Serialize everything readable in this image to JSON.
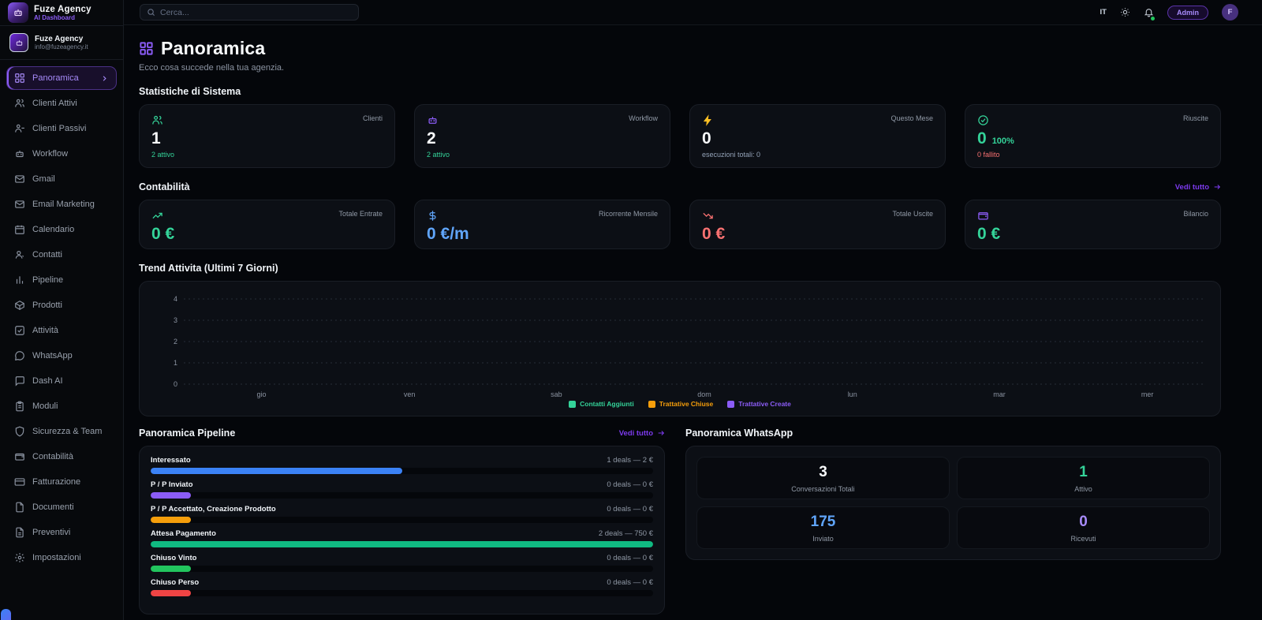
{
  "app": {
    "name": "Fuze Agency",
    "subtitle": "AI Dashboard"
  },
  "account": {
    "name": "Fuze Agency",
    "email": "info@fuzeagency.it"
  },
  "topbar": {
    "search_placeholder": "Cerca...",
    "language": "IT",
    "admin_badge": "Admin",
    "avatar_initial": "F"
  },
  "sidebar": {
    "items": [
      {
        "label": "Panoramica",
        "icon": "grid-icon",
        "active": true
      },
      {
        "label": "Clienti Attivi",
        "icon": "users-icon",
        "active": false
      },
      {
        "label": "Clienti Passivi",
        "icon": "user-minus-icon",
        "active": false
      },
      {
        "label": "Workflow",
        "icon": "bot-icon",
        "active": false
      },
      {
        "label": "Gmail",
        "icon": "mail-icon",
        "active": false
      },
      {
        "label": "Email Marketing",
        "icon": "mail-icon",
        "active": false
      },
      {
        "label": "Calendario",
        "icon": "calendar-icon",
        "active": false
      },
      {
        "label": "Contatti",
        "icon": "contact-icon",
        "active": false
      },
      {
        "label": "Pipeline",
        "icon": "bar-chart-icon",
        "active": false
      },
      {
        "label": "Prodotti",
        "icon": "package-icon",
        "active": false
      },
      {
        "label": "Attività",
        "icon": "check-square-icon",
        "active": false
      },
      {
        "label": "WhatsApp",
        "icon": "message-circle-icon",
        "active": false
      },
      {
        "label": "Dash AI",
        "icon": "message-square-icon",
        "active": false
      },
      {
        "label": "Moduli",
        "icon": "clipboard-icon",
        "active": false
      },
      {
        "label": "Sicurezza & Team",
        "icon": "shield-icon",
        "active": false
      },
      {
        "label": "Contabilità",
        "icon": "wallet-icon",
        "active": false
      },
      {
        "label": "Fatturazione",
        "icon": "credit-card-icon",
        "active": false
      },
      {
        "label": "Documenti",
        "icon": "file-icon",
        "active": false
      },
      {
        "label": "Preventivi",
        "icon": "file-text-icon",
        "active": false
      },
      {
        "label": "Impostazioni",
        "icon": "settings-icon",
        "active": false
      }
    ]
  },
  "page": {
    "title": "Panoramica",
    "subtitle": "Ecco cosa succede nella tua agenzia."
  },
  "sections": {
    "system": {
      "title": "Statistiche di Sistema",
      "cards": [
        {
          "label": "Clienti",
          "value": "1",
          "sub": "2 attivo",
          "icon": "users-icon",
          "icon_color": "#34d399",
          "value_color": "#f8fafc",
          "sub_color": "#34d399"
        },
        {
          "label": "Workflow",
          "value": "2",
          "sub": "2 attivo",
          "icon": "bot-icon",
          "icon_color": "#8b5cf6",
          "value_color": "#f8fafc",
          "sub_color": "#34d399"
        },
        {
          "label": "Questo Mese",
          "value": "0",
          "sub": "esecuzioni totali: 0",
          "icon": "zap-icon",
          "icon_color": "#fbbf24",
          "value_color": "#f8fafc",
          "sub_color": "#94a3b8"
        },
        {
          "label": "Riuscite",
          "value": "0",
          "value_suffix": "100%",
          "sub": "0 fallito",
          "icon": "check-circle-icon",
          "icon_color": "#34d399",
          "value_color": "#34d399",
          "sub_color": "#f87171"
        }
      ]
    },
    "accounting": {
      "title": "Contabilità",
      "link_label": "Vedi tutto",
      "cards": [
        {
          "label": "Totale Entrate",
          "value": "0 €",
          "icon": "trending-up-icon",
          "icon_color": "#34d399",
          "value_color": "#34d399"
        },
        {
          "label": "Ricorrente Mensile",
          "value": "0 €/m",
          "icon": "dollar-icon",
          "icon_color": "#60a5fa",
          "value_color": "#60a5fa"
        },
        {
          "label": "Totale Uscite",
          "value": "0 €",
          "icon": "trending-down-icon",
          "icon_color": "#f87171",
          "value_color": "#f87171"
        },
        {
          "label": "Bilancio",
          "value": "0 €",
          "icon": "wallet-icon",
          "icon_color": "#8b5cf6",
          "value_color": "#34d399"
        }
      ]
    },
    "trend": {
      "title": "Trend Attivita (Ultimi 7 Giorni)"
    },
    "pipeline": {
      "title": "Panoramica Pipeline",
      "link_label": "Vedi tutto",
      "stages": [
        {
          "label": "Interessato",
          "deals": "1 deals — 2 €",
          "width_pct": "50%",
          "color": "#3b82f6"
        },
        {
          "label": "P / P Inviato",
          "deals": "0 deals — 0 €",
          "width_pct": "8%",
          "color": "#8b5cf6"
        },
        {
          "label": "P / P Accettato, Creazione Prodotto",
          "deals": "0 deals — 0 €",
          "width_pct": "8%",
          "color": "#f59e0b"
        },
        {
          "label": "Attesa Pagamento",
          "deals": "2 deals — 750 €",
          "width_pct": "100%",
          "color": "#10b981"
        },
        {
          "label": "Chiuso Vinto",
          "deals": "0 deals — 0 €",
          "width_pct": "8%",
          "color": "#22c55e"
        },
        {
          "label": "Chiuso Perso",
          "deals": "0 deals — 0 €",
          "width_pct": "8%",
          "color": "#ef4444"
        }
      ]
    },
    "whatsapp": {
      "title": "Panoramica WhatsApp",
      "stats": [
        {
          "value": "3",
          "label": "Conversazioni Totali",
          "color": "#f8fafc"
        },
        {
          "value": "1",
          "label": "Attivo",
          "color": "#34d399"
        },
        {
          "value": "175",
          "label": "Inviato",
          "color": "#60a5fa"
        },
        {
          "value": "0",
          "label": "Ricevuti",
          "color": "#a78bfa"
        }
      ]
    }
  },
  "chart_data": {
    "type": "line",
    "title": "Trend Attivita (Ultimi 7 Giorni)",
    "x": [
      "gio",
      "ven",
      "sab",
      "dom",
      "lun",
      "mar",
      "mer"
    ],
    "yticks": [
      0,
      1,
      2,
      3,
      4
    ],
    "ylim": [
      0,
      4
    ],
    "grid": true,
    "legend_position": "bottom",
    "series": [
      {
        "name": "Contatti Aggiunti",
        "color": "#34d399",
        "values": [
          0,
          0,
          0,
          0,
          0,
          0,
          0
        ]
      },
      {
        "name": "Trattative Chiuse",
        "color": "#f59e0b",
        "values": [
          0,
          0,
          0,
          0,
          0,
          0,
          0
        ]
      },
      {
        "name": "Trattative Create",
        "color": "#8b5cf6",
        "values": [
          0,
          0,
          0,
          0,
          0,
          0,
          0
        ]
      }
    ]
  }
}
